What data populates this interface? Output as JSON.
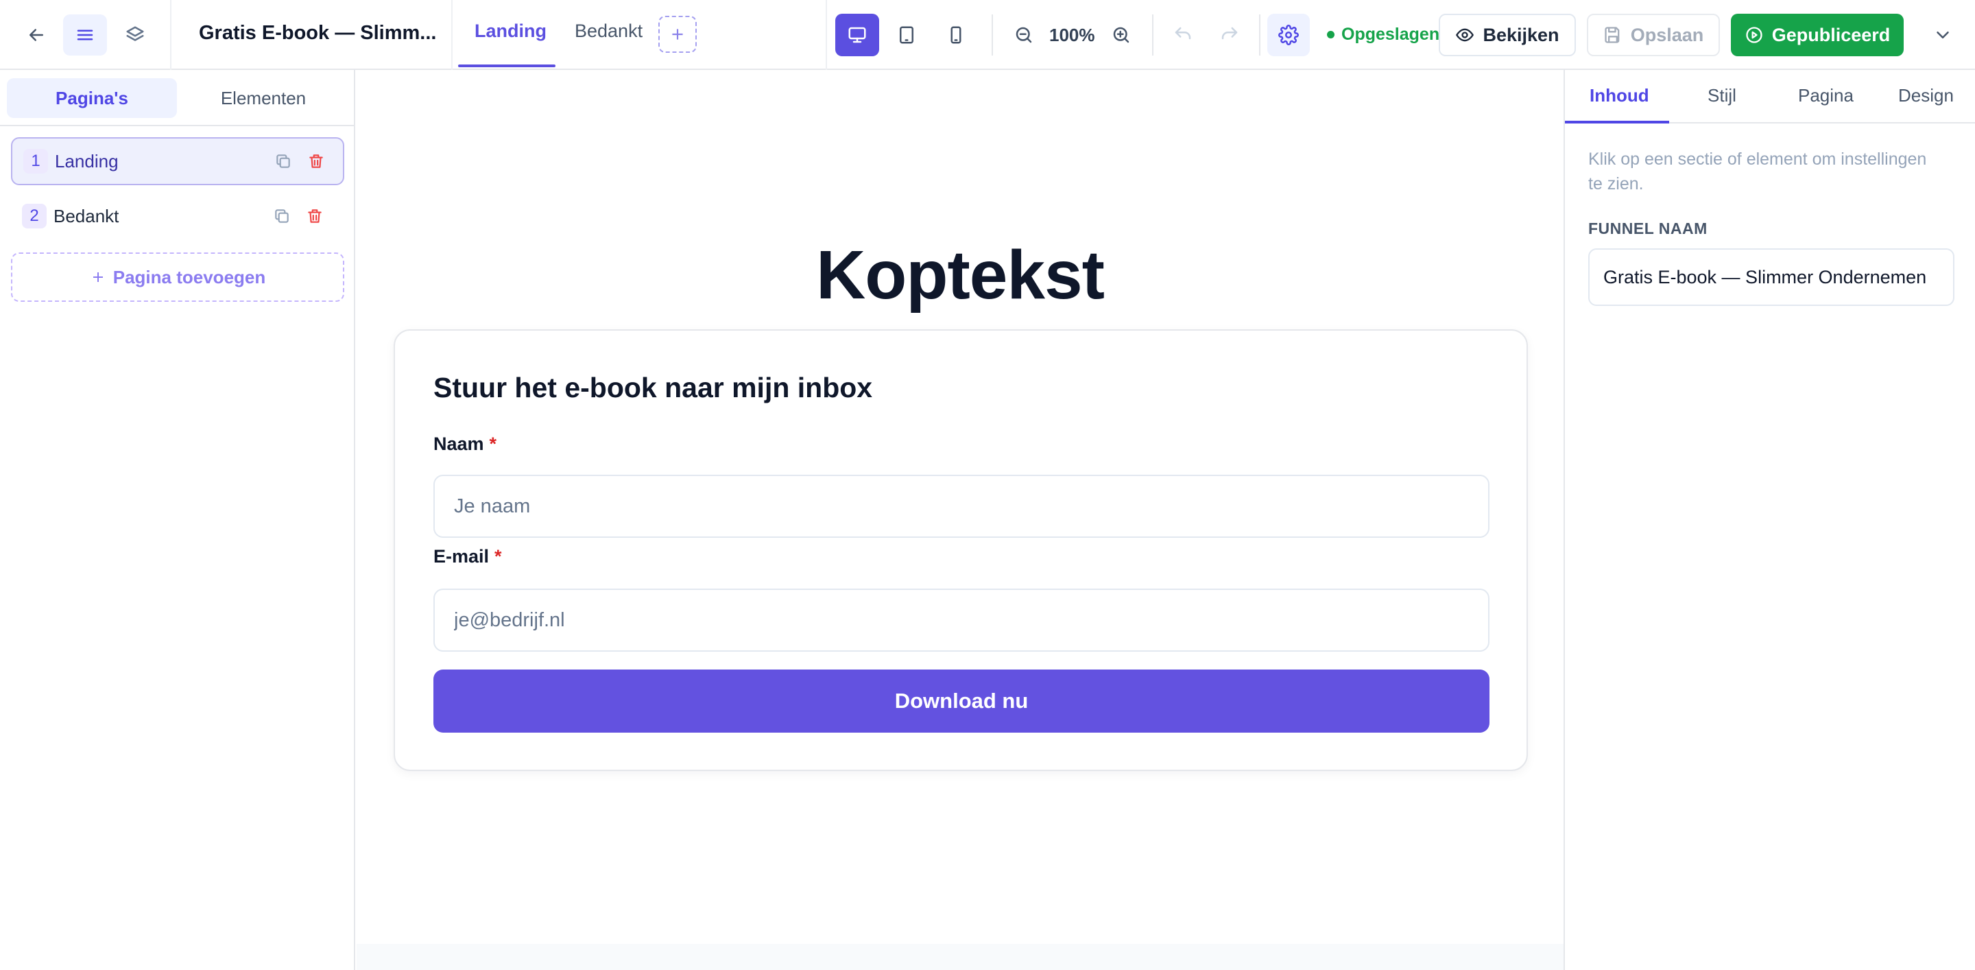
{
  "header": {
    "funnel_title": "Gratis E-book — Slimm...",
    "page_tabs": [
      {
        "label": "Landing",
        "active": true
      },
      {
        "label": "Bedankt",
        "active": false
      }
    ],
    "zoom": "100%",
    "saved_status": "Opgeslagen",
    "view_label": "Bekijken",
    "save_label": "Opslaan",
    "publish_label": "Gepubliceerd",
    "icons": [
      "arrow-left-icon",
      "menu-icon",
      "layers-icon",
      "plus-icon",
      "desktop-icon",
      "tablet-icon",
      "mobile-icon",
      "zoom-out-icon",
      "zoom-in-icon",
      "undo-icon",
      "redo-icon",
      "gear-icon",
      "eye-icon",
      "save-icon",
      "play-circle-icon",
      "chevron-down-icon"
    ]
  },
  "left": {
    "tabs": [
      {
        "label": "Pagina's",
        "active": true
      },
      {
        "label": "Elementen",
        "active": false
      }
    ],
    "pages": [
      {
        "num": "1",
        "name": "Landing",
        "active": true
      },
      {
        "num": "2",
        "name": "Bedankt",
        "active": false
      }
    ],
    "add_page_label": "Pagina toevoegen"
  },
  "canvas": {
    "heading": "Koptekst",
    "form": {
      "title": "Stuur het e-book naar mijn inbox",
      "name_label": "Naam",
      "name_placeholder": "Je naam",
      "email_label": "E-mail",
      "email_placeholder": "je@bedrijf.nl",
      "required_mark": "*",
      "submit_label": "Download nu"
    }
  },
  "right": {
    "tabs": [
      {
        "label": "Inhoud",
        "active": true
      },
      {
        "label": "Stijl",
        "active": false
      },
      {
        "label": "Pagina",
        "active": false
      },
      {
        "label": "Design",
        "active": false
      }
    ],
    "hint": "Klik op een sectie of element om instellingen te zien.",
    "funnel_name_label": "FUNNEL NAAM",
    "funnel_name_value": "Gratis E-book — Slimmer Ondernemen"
  },
  "colors": {
    "accent": "#5b4fe0",
    "publish_green": "#16a34a",
    "danger": "#dc2626"
  }
}
